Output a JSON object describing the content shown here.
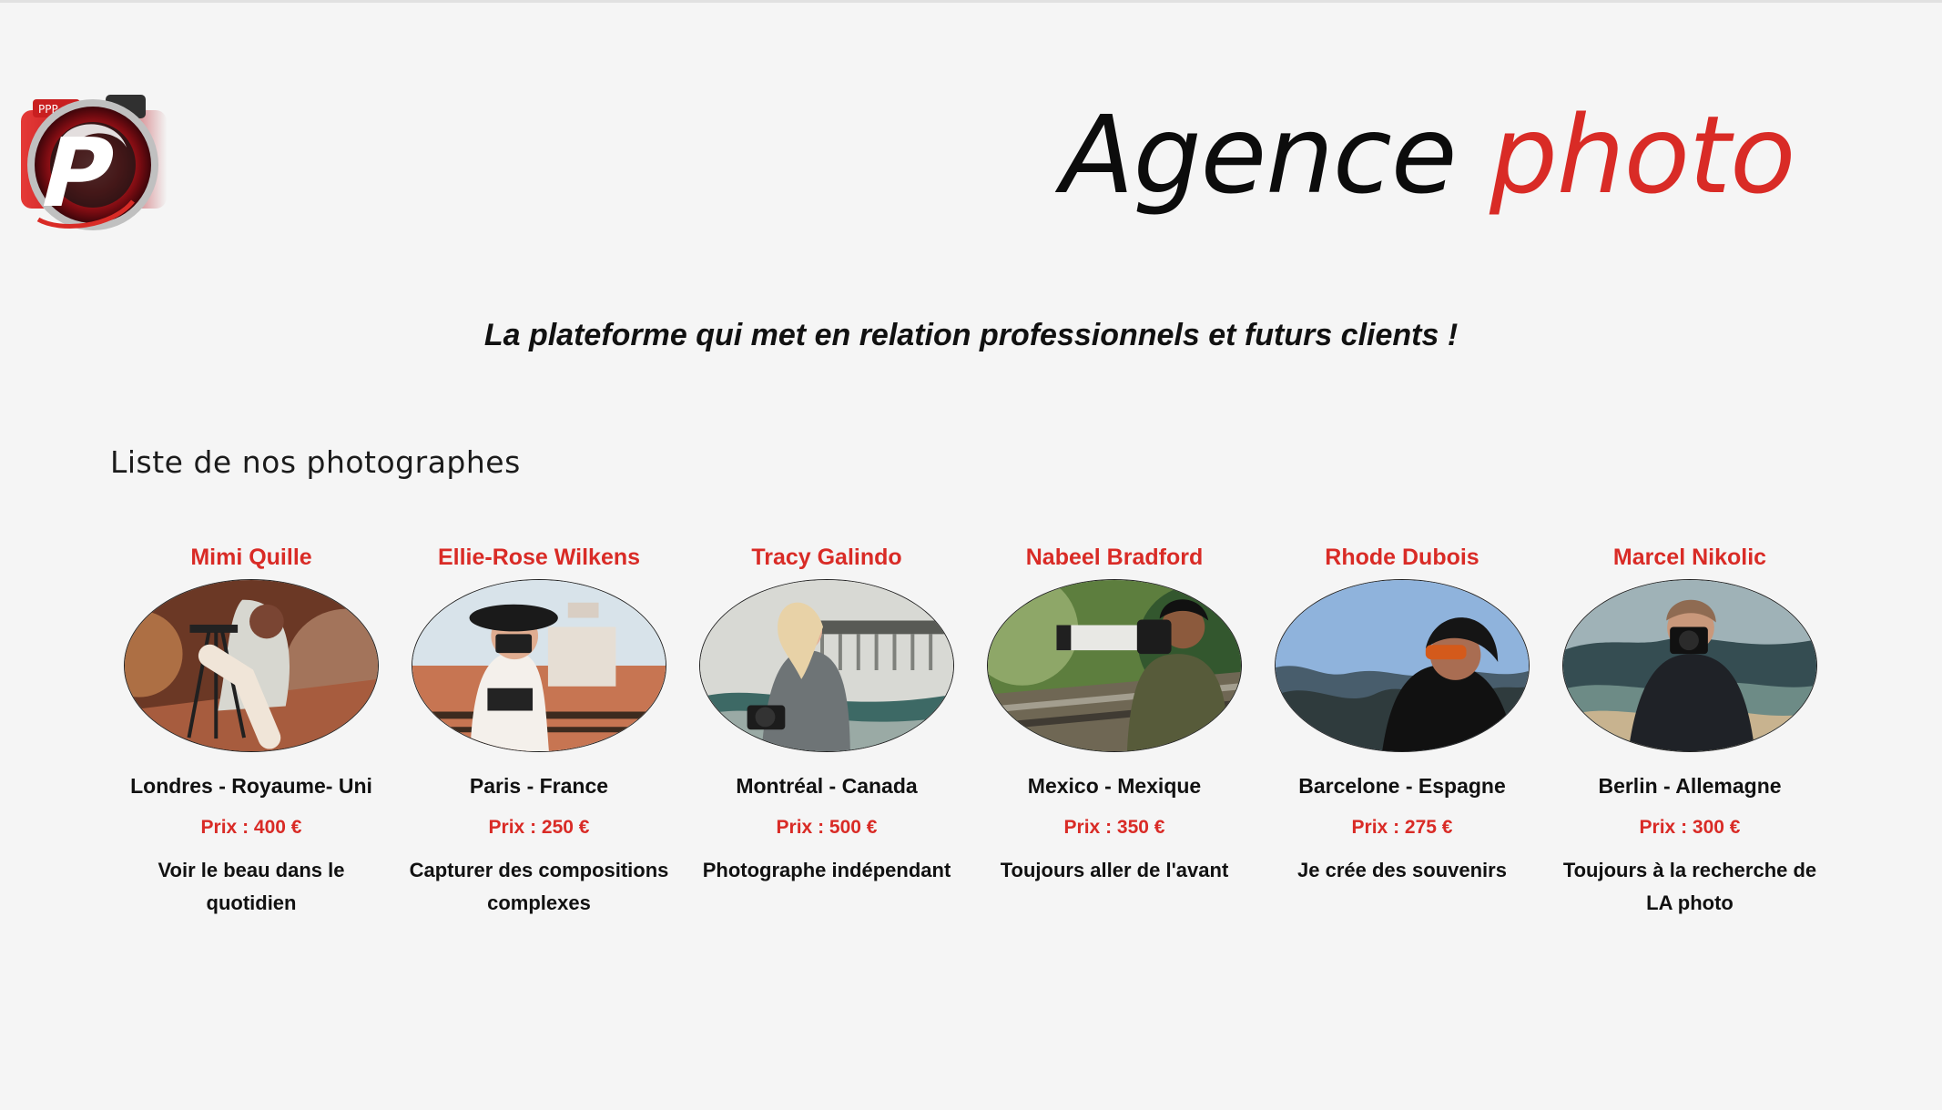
{
  "header": {
    "title_part1": "Agence",
    "title_part2": "photo",
    "tagline": "La plateforme qui met en relation professionnels et futurs clients !"
  },
  "logo": {
    "label": "PPP"
  },
  "section": {
    "title": "Liste de nos photographes"
  },
  "photographers": [
    {
      "name": "Mimi Quille",
      "location": "Londres - Royaume- Uni",
      "price": "Prix : 400 €",
      "tagline": "Voir le beau dans le quotidien"
    },
    {
      "name": "Ellie-Rose Wilkens",
      "location": "Paris - France",
      "price": "Prix : 250 €",
      "tagline": "Capturer des compositions complexes"
    },
    {
      "name": "Tracy Galindo",
      "location": "Montréal - Canada",
      "price": "Prix : 500 €",
      "tagline": "Photographe indépendant"
    },
    {
      "name": "Nabeel Bradford",
      "location": "Mexico - Mexique",
      "price": "Prix : 350 €",
      "tagline": "Toujours aller de l'avant"
    },
    {
      "name": "Rhode Dubois",
      "location": "Barcelone - Espagne",
      "price": "Prix : 275 €",
      "tagline": "Je crée des souvenirs"
    },
    {
      "name": "Marcel Nikolic",
      "location": "Berlin - Allemagne",
      "price": "Prix : 300 €",
      "tagline": "Toujours à la recherche de LA photo"
    }
  ],
  "colors": {
    "accent": "#d92b26",
    "text": "#111111",
    "background": "#f5f5f5"
  },
  "icons": {
    "logo": "camera-logo-icon"
  }
}
